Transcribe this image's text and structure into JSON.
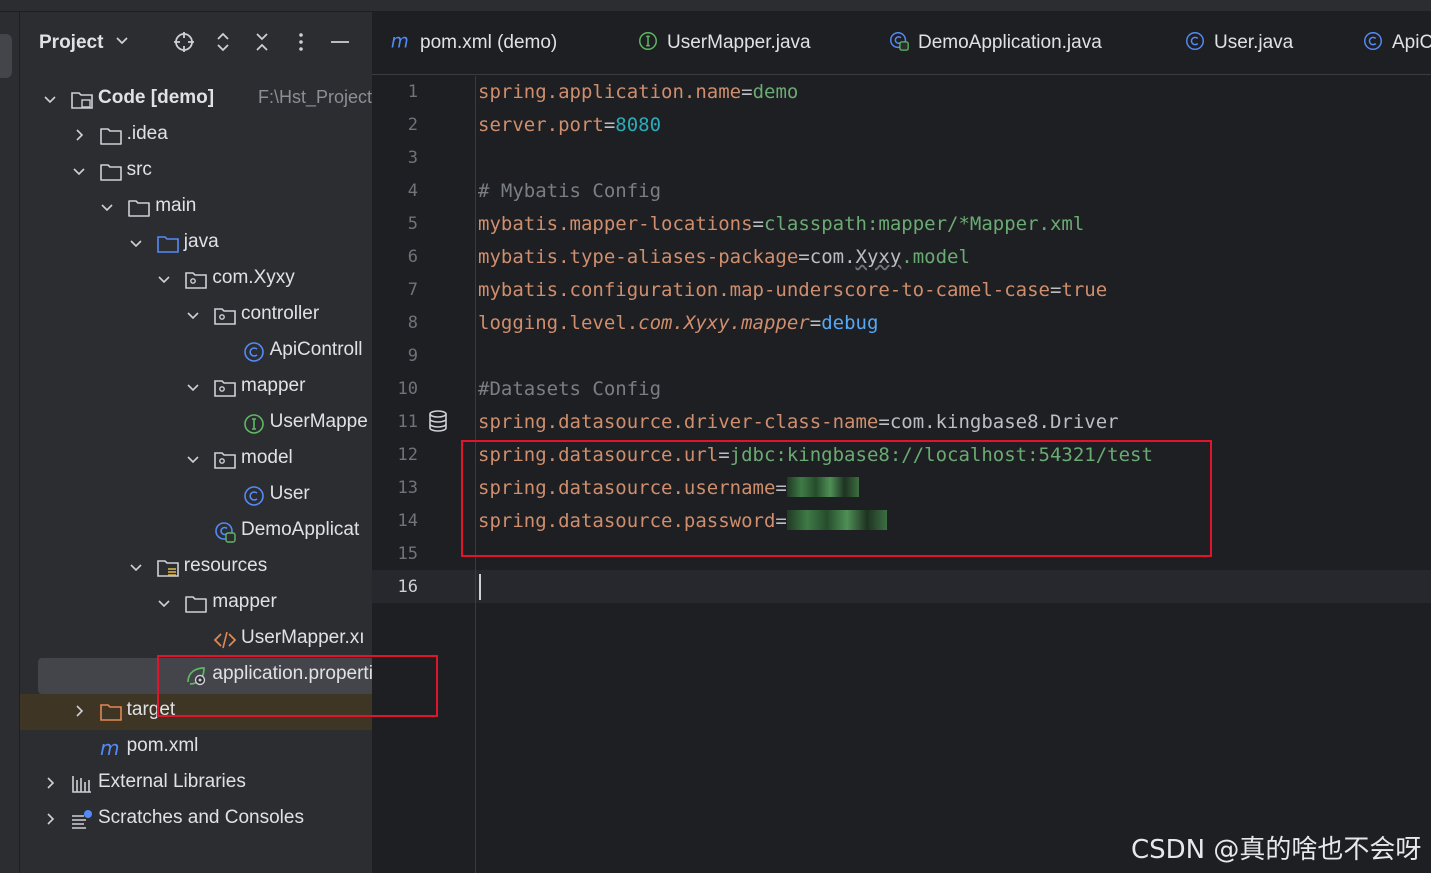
{
  "panel": {
    "title": "Project",
    "header_icons": [
      "crosshair-icon",
      "expand-icon",
      "collapse-icon",
      "more-icon",
      "minimize-icon"
    ]
  },
  "tree": [
    {
      "label": "Code [demo]",
      "sub": "F:\\Hst_Project\\I",
      "icon": "module-folder-icon",
      "expanded": true
    },
    {
      "label": ".idea",
      "icon": "folder-icon",
      "expanded": false
    },
    {
      "label": "src",
      "icon": "folder-icon",
      "expanded": true
    },
    {
      "label": "main",
      "icon": "folder-icon",
      "expanded": true
    },
    {
      "label": "java",
      "icon": "source-folder-icon",
      "expanded": true
    },
    {
      "label": "com.Xyxy",
      "icon": "package-icon",
      "expanded": true
    },
    {
      "label": "controller",
      "icon": "package-icon",
      "expanded": true
    },
    {
      "label": "ApiControll",
      "icon": "class-icon"
    },
    {
      "label": "mapper",
      "icon": "package-icon",
      "expanded": true
    },
    {
      "label": "UserMappe",
      "icon": "interface-icon"
    },
    {
      "label": "model",
      "icon": "package-icon",
      "expanded": true
    },
    {
      "label": "User",
      "icon": "class-icon"
    },
    {
      "label": "DemoApplicat",
      "icon": "spring-boot-class-icon"
    },
    {
      "label": "resources",
      "icon": "resources-folder-icon",
      "expanded": true
    },
    {
      "label": "mapper",
      "icon": "folder-icon",
      "expanded": true
    },
    {
      "label": "UserMapper.xı",
      "icon": "xml-file-icon"
    },
    {
      "label": "application.properties",
      "icon": "spring-properties-icon",
      "selected": true
    },
    {
      "label": "target",
      "icon": "excluded-folder-icon",
      "expanded": false
    },
    {
      "label": "pom.xml",
      "icon": "maven-icon"
    },
    {
      "label": "External Libraries",
      "icon": "libraries-icon",
      "expanded": false
    },
    {
      "label": "Scratches and Consoles",
      "icon": "scratches-icon",
      "expanded": false
    }
  ],
  "tabs": [
    {
      "label": "pom.xml (demo)",
      "icon": "maven-icon"
    },
    {
      "label": "UserMapper.java",
      "icon": "interface-icon"
    },
    {
      "label": "DemoApplication.java",
      "icon": "spring-boot-class-icon"
    },
    {
      "label": "User.java",
      "icon": "class-icon"
    },
    {
      "label": "ApiC",
      "icon": "class-icon"
    }
  ],
  "line_numbers": [
    "1",
    "2",
    "3",
    "4",
    "5",
    "6",
    "7",
    "8",
    "9",
    "10",
    "11",
    "12",
    "13",
    "14",
    "15",
    "16"
  ],
  "code": {
    "l1_key": "spring.application.name",
    "l1_val": "demo",
    "l2_key": "server.port",
    "l2_val": "8080",
    "l4_comment": "# Mybatis Config",
    "l5_key": "mybatis.mapper-locations",
    "l5_val": "classpath:mapper/*Mapper.xml",
    "l6_key": "mybatis.type-aliases-package",
    "l6_val_a": "com.",
    "l6_val_b": "Xyxy",
    "l6_val_c": ".model",
    "l7_key": "mybatis.configuration.map-underscore-to-camel-case",
    "l7_val": "true",
    "l8_key_a": "logging.level.",
    "l8_key_b": "com.Xyxy.mapper",
    "l8_val": "debug",
    "l10_comment": "#Datasets Config",
    "l11_key": "spring.datasource.driver-class-name",
    "l11_val": "com.kingbase8.Driver",
    "l12_key": "spring.datasource.url",
    "l12_val": "jdbc:kingbase8://localhost:54321/test",
    "l13_key": "spring.datasource.username",
    "l14_key": "spring.datasource.password",
    "eq": "="
  },
  "colors": {
    "key": "#cf8e6d",
    "value": "#6aab73",
    "number": "#2aacb8",
    "comment": "#7a7e85",
    "highlight_box": "#e0152b"
  },
  "watermark": "CSDN @真的啥也不会呀"
}
